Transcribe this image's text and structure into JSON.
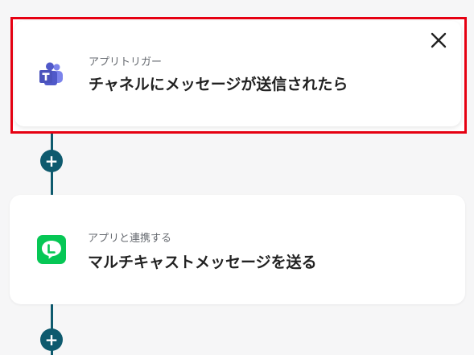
{
  "steps": [
    {
      "app_label": "アプリトリガー",
      "action": "チャネルにメッセージが送信されたら",
      "app_icon": "microsoft-teams-icon",
      "selected": true
    },
    {
      "app_label": "アプリと連携する",
      "action": "マルチキャストメッセージを送る",
      "app_icon": "line-icon",
      "selected": false
    }
  ],
  "add_step_symbol": "+",
  "colors": {
    "connector": "#0e5a6e",
    "selection_border": "#e60012",
    "teams_purple": "#5059c9",
    "line_green": "#06c755"
  }
}
